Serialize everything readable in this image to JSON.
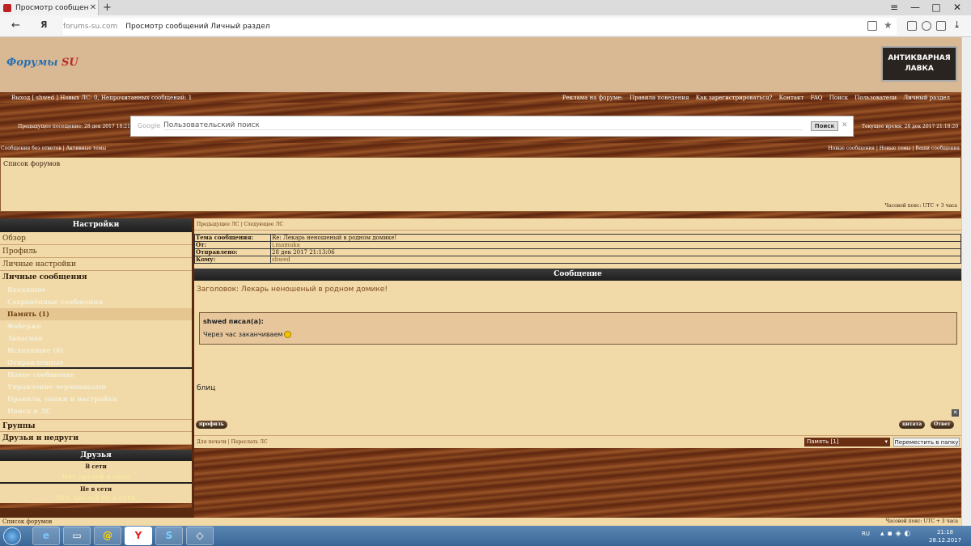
{
  "browser": {
    "tab_title": "Просмотр сообщений Л",
    "new_tab": "+",
    "back": "←",
    "address_domain": "forums-su.com",
    "address_page": "Просмотр сообщений Личный раздел",
    "minimize": "—",
    "maximize": "□",
    "close": "✕",
    "menu": "≡"
  },
  "header": {
    "logo_main": "Форумы",
    "logo_accent": "SU",
    "banner_line1": "АНТИКВАРНАЯ",
    "banner_line2": "ЛАВКА"
  },
  "topnav": {
    "left": "Выход [ shwed ]   Новых ЛС: 0, Непрочитанных сообщений: 1",
    "right": [
      "Реклама на форуме:",
      "Правила поведения",
      "Как зарегистрироваться?",
      "Контакт",
      "FAQ",
      "Поиск",
      "Пользователи",
      "Личный раздел"
    ]
  },
  "search": {
    "prev_visit": "Предыдущее посещение: 28 дек 2017 18:21:48",
    "current_time": "Текущее время: 28 дек 2017 21:18:20",
    "google_label": "Google",
    "placeholder": "Пользовательский поиск",
    "button": "Поиск",
    "clear": "✕"
  },
  "links": {
    "left": "Сообщения без ответов  |  Активные темы",
    "right": "Новые сообщения | Новые темы | Ваши сообщения"
  },
  "forumlist": {
    "title": "Список форумов",
    "timezone": "Часовой пояс: UTC + 3 часа"
  },
  "sidebar": {
    "settings_title": "Настройки",
    "items": [
      "Обзор",
      "Профиль",
      "Личные настройки"
    ],
    "pm_title": "Личные сообщения",
    "folders": [
      "Входящие",
      "Сохранённые сообщения",
      "Память (1)",
      "Фаберже",
      "Запасная",
      "Исходящие (6)",
      "Отправленные"
    ],
    "actions": [
      "Новое сообщение",
      "Управление черновиками",
      "Правила, папки и настройки",
      "Поиск в ЛС"
    ],
    "groups": "Группы",
    "friends_foes": "Друзья и недруги",
    "friends_title": "Друзья",
    "online": "В сети",
    "online_none": "Нет друзей в сети",
    "offline": "Не в сети",
    "offline_none": "Нет друзей не в сети"
  },
  "message": {
    "pm_nav": "Предыдущее ЛС  |  Следующее ЛС",
    "meta": [
      {
        "k": "Тема сообщения:",
        "v": "Re: Лекарь неношеный в родном домике!"
      },
      {
        "k": "От:",
        "v": "i.mamuka"
      },
      {
        "k": "Отправлено:",
        "v": "28 дек 2017 21:13:06"
      },
      {
        "k": "Кому:",
        "v": "shwed"
      }
    ],
    "header": "Сообщение",
    "subject": "Заголовок: Лекарь неношеный в родном домике!",
    "quote_author": "shwed писал(а):",
    "quote_text": "Через час заканчиваем",
    "body": "блиц",
    "close": "✕",
    "btn_profile": "профиль",
    "btn_quote": "цитата",
    "btn_reply": "Ответ",
    "footer_links": "Для печати  |  Переслать ЛС",
    "move_select": "Память [1]",
    "move_button": "Переместить в папку"
  },
  "bottom": {
    "left": "Список форумов",
    "right": "Часовой пояс: UTC + 3 часа"
  },
  "taskbar": {
    "yandex": "Y",
    "mail": "@",
    "lang": "RU",
    "time": "21:18",
    "date": "28.12.2017"
  }
}
